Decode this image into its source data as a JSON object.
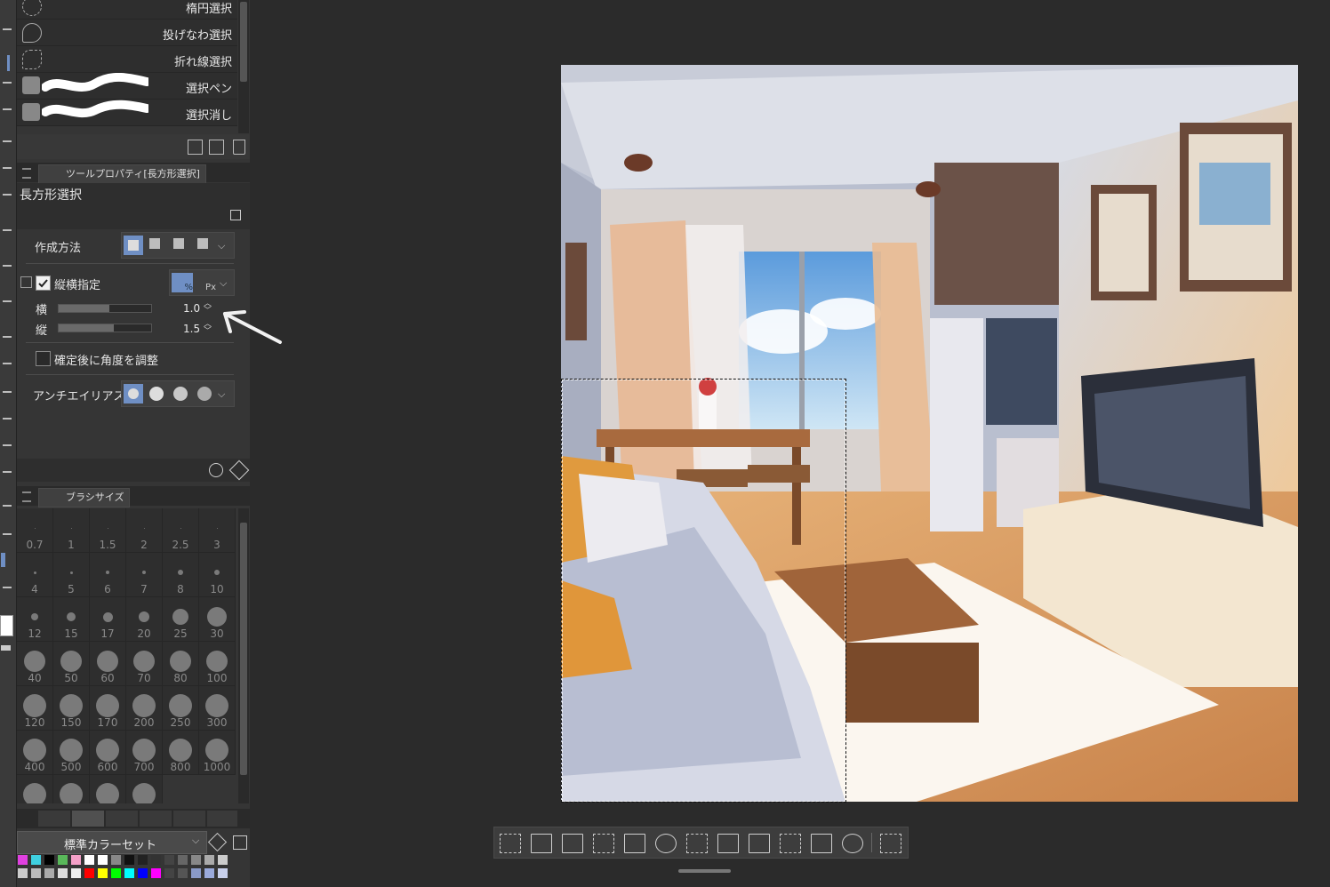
{
  "subtools": [
    {
      "label": "楕円選択",
      "icon": "ellipse-select-icon"
    },
    {
      "label": "投げなわ選択",
      "icon": "lasso-select-icon"
    },
    {
      "label": "折れ線選択",
      "icon": "polyline-select-icon"
    },
    {
      "label": "選択ペン",
      "icon": "selection-pen-icon"
    },
    {
      "label": "選択消し",
      "icon": "selection-eraser-icon"
    }
  ],
  "tool_property": {
    "tab_label": "ツールプロパティ[長方形選択]",
    "tool_name": "長方形選択",
    "creation_method_label": "作成方法",
    "aspect_label": "縦横指定",
    "width_label": "横",
    "width_value": "1.0",
    "width_level": 0.55,
    "height_label": "縦",
    "height_value": "1.5",
    "height_level": 0.6,
    "angle_adjust_label": "確定後に角度を調整",
    "antialias_label": "アンチエイリアス",
    "percent_unit": "%",
    "px_unit": "Px"
  },
  "brush_size": {
    "tab_label": "ブラシサイズ",
    "sizes": [
      "0.7",
      "1",
      "1.5",
      "2",
      "2.5",
      "3",
      "4",
      "5",
      "6",
      "7",
      "8",
      "10",
      "12",
      "15",
      "17",
      "20",
      "25",
      "30",
      "40",
      "50",
      "60",
      "70",
      "80",
      "100",
      "120",
      "150",
      "170",
      "200",
      "250",
      "300",
      "400",
      "500",
      "600",
      "700",
      "800",
      "1000",
      "",
      "",
      "",
      ""
    ]
  },
  "color_set": {
    "selected": "標準カラーセット",
    "row1": [
      "#e040e0",
      "#3fd0e0",
      "#000000",
      "#59b85a",
      "#f4a0c8",
      "#ffffff",
      "#ffffff",
      "#888888",
      "#111111",
      "#222222",
      "#333333",
      "#444444",
      "#666666",
      "#888888",
      "#aaaaaa",
      "#cccccc"
    ],
    "row2": [
      "#cccccc",
      "#bbbbbb",
      "#aaaaaa",
      "#dddddd",
      "#eeeeee",
      "#ff0000",
      "#ffff00",
      "#00ff00",
      "#00ffff",
      "#0000ff",
      "#ff00ff",
      "#444444",
      "#555555",
      "#8a9ac8",
      "#9aaadc",
      "#c8d0ec"
    ]
  },
  "selection_bar": {
    "icons": [
      "deselect-icon",
      "select-all-icon",
      "invert-selection-icon",
      "scale-rotate-selection-icon",
      "shrink-selection-icon",
      "expand-selection-icon",
      "selection-launcher-icon",
      "cut-paste-icon",
      "copy-paste-icon",
      "transform-icon",
      "fill-icon",
      "new-tone-icon",
      "selection-settings-icon"
    ]
  }
}
